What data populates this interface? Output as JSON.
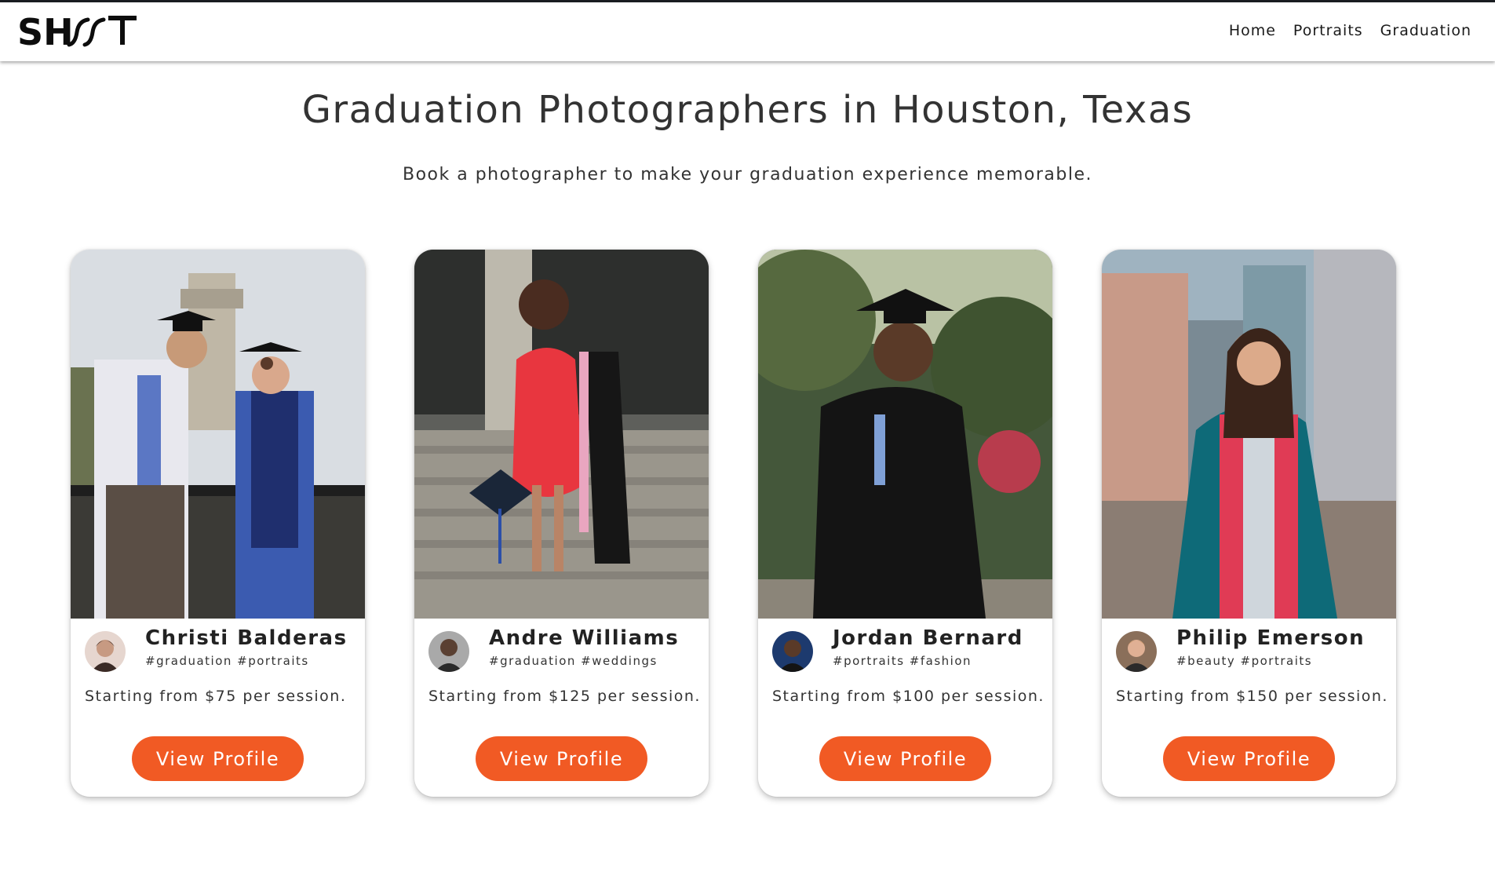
{
  "brand": {
    "logo_text": "SH∕∕T",
    "accent": "#f15a24"
  },
  "nav": {
    "items": [
      "Home",
      "Portraits",
      "Graduation"
    ]
  },
  "hero": {
    "title": "Graduation Photographers in Houston, Texas",
    "subtitle": "Book a photographer to make your graduation experience memorable."
  },
  "photographers": [
    {
      "name": "Christi Balderas",
      "tags": "#graduation #portraits",
      "price": "Starting from $75 per session.",
      "button": "View Profile"
    },
    {
      "name": "Andre Williams",
      "tags": "#graduation #weddings",
      "price": "Starting from $125 per session.",
      "button": "View Profile"
    },
    {
      "name": "Jordan Bernard",
      "tags": "#portraits #fashion",
      "price": "Starting from $100 per session.",
      "button": "View Profile"
    },
    {
      "name": "Philip Emerson",
      "tags": "#beauty #portraits",
      "price": "Starting from $150 per session.",
      "button": "View Profile"
    }
  ]
}
